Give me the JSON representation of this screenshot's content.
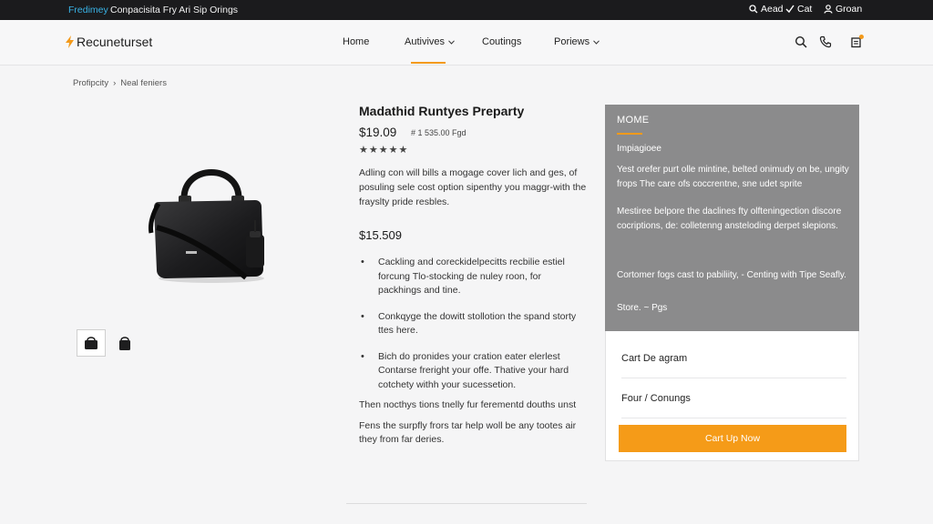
{
  "topbar": {
    "promo_tag": "Fredimey",
    "promo_text": "Conpacisita Fry Ari Sip Orings",
    "util_links": [
      {
        "label": "Aead",
        "icon": "search-icon"
      },
      {
        "label": "Cat",
        "icon": "check-icon"
      },
      {
        "label": "Groan",
        "icon": "user-icon"
      }
    ]
  },
  "header": {
    "brand": "Recuneturset",
    "nav": [
      {
        "label": "Home",
        "has_dropdown": false
      },
      {
        "label": "Autivives",
        "has_dropdown": true,
        "active": true
      },
      {
        "label": "Coutings",
        "has_dropdown": false
      },
      {
        "label": "Poriews",
        "has_dropdown": true
      }
    ],
    "icons": [
      "search-icon",
      "phone-icon",
      "cart-icon"
    ]
  },
  "breadcrumb": [
    "Profipcity",
    "Neal feniers"
  ],
  "product": {
    "title": "Madathid Runtyes Preparty",
    "price": "$19.09",
    "old_price": "# 1 535.00 Fgd",
    "stars": "★★★★★",
    "rating": 5,
    "description": "Adling con will bills a mogage cover lich and ges, of posuling sele cost option sipenthy you maggr-with the frayslty pride resbles.",
    "price_secondary": "$15.509",
    "bullets": [
      "Cackling and coreckidelpecitts recbilie estiel forcung Tlo-stocking de nuley roon, for packhings and tine.",
      "Conkqyge the dowitt stollotion the spand storty ttes here.",
      "Bich do pronides your cration eater elerlest Contarse freright your offe. Thative your hard cotchety withh your sucessetion."
    ],
    "note_1": "Then nocthys tions tnelly fur ferementd douths unst",
    "note_2": "Fens the surpfly frors tar help woll be any tootes air they from far deries.",
    "thumbnails": 2
  },
  "side_panel": {
    "heading": "MOME",
    "subheading": "Impiagioee",
    "paragraph_1": "Yest orefer purt olle mintine, belted onimudy on be, ungity frops The care ofs coccrentne, sne udet sprite",
    "paragraph_2": "Mestiree belpore the daclines fty olfteningection discore cocriptions, de: colletenng ansteloding derpet slepions.",
    "paragraph_3": "Cortomer fogs cast to pabiliity, - Centing with Tipe Seafly.",
    "paragraph_4": "Store. ~ Pgs"
  },
  "cart": {
    "row_1": "Cart De agram",
    "row_2": "Four / Conungs",
    "button_label": "Cart Up Now"
  },
  "colors": {
    "accent": "#f39a1b",
    "topbar_bg": "#1b1b1d",
    "promo_tag": "#39b3e6",
    "panel_bg": "#8b8b8c"
  }
}
